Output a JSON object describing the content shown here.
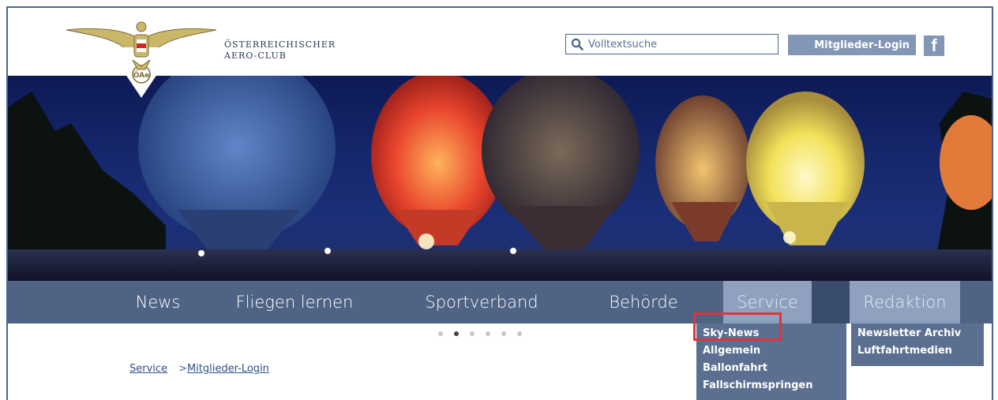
{
  "header": {
    "org_name_line1": "ÖSTERREICHISCHER",
    "org_name_line2": "AERO-CLUB",
    "search_placeholder": "Volltextsuche",
    "login_label": "Mitglieder-Login",
    "facebook_glyph": "f"
  },
  "nav": {
    "items": [
      {
        "label": "News"
      },
      {
        "label": "Fliegen lernen"
      },
      {
        "label": "Sportverband"
      },
      {
        "label": "Behörde"
      },
      {
        "label": "Service"
      },
      {
        "label": "Redaktion"
      }
    ],
    "active": "Service"
  },
  "slider": {
    "total": 6,
    "current": 2
  },
  "breadcrumb": {
    "items": [
      {
        "label": "Service"
      },
      {
        "label": "Mitglieder-Login"
      }
    ],
    "separator": ">"
  },
  "dropdowns": {
    "service": [
      "Sky-News",
      "Allgemein",
      "Ballonfahrt",
      "Fallschirmspringen"
    ],
    "redaktion": [
      "Newsletter Archiv",
      "Luftfahrtmedien"
    ]
  },
  "colors": {
    "nav_bg": "#4f6385",
    "nav_active": "#8fa1bf",
    "accent": "#8396b6",
    "highlight": "#e0333a",
    "border": "#4a6690"
  },
  "icons": [
    "search-icon",
    "facebook-icon",
    "eagle-logo-icon"
  ]
}
